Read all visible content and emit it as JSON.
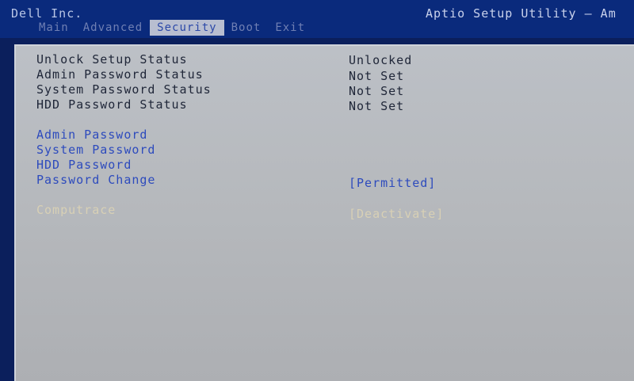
{
  "header": {
    "vendor": "Dell Inc.",
    "utility_title": "Aptio Setup Utility – Am"
  },
  "tabs": [
    {
      "label": "Main",
      "active": false
    },
    {
      "label": "Advanced",
      "active": false
    },
    {
      "label": "Security",
      "active": true
    },
    {
      "label": "Boot",
      "active": false
    },
    {
      "label": "Exit",
      "active": false
    }
  ],
  "status": [
    {
      "label": "Unlock Setup Status",
      "value": "Unlocked"
    },
    {
      "label": "Admin Password Status",
      "value": "Not Set"
    },
    {
      "label": "System Password Status",
      "value": "Not Set"
    },
    {
      "label": "HDD Password Status",
      "value": "Not Set"
    }
  ],
  "options": [
    {
      "label": "Admin Password",
      "value": ""
    },
    {
      "label": "System Password",
      "value": ""
    },
    {
      "label": "HDD Password",
      "value": ""
    },
    {
      "label": "Password Change",
      "value": "[Permitted]"
    }
  ],
  "disabled_option": {
    "label": "Computrace",
    "value": "[Deactivate]"
  },
  "colors": {
    "tab_bar": "#0a2a7c",
    "panel": "#b8bbbf",
    "option_text": "#2d4bbd",
    "active_tab_bg": "#b8bed0"
  }
}
